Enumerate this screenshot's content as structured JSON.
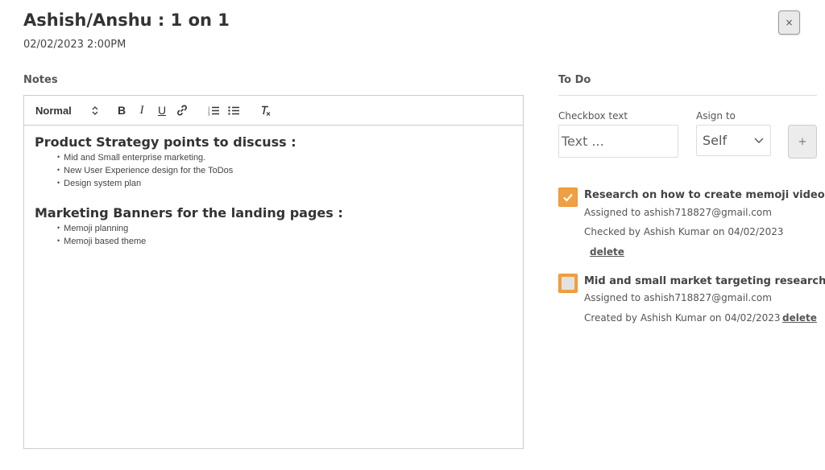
{
  "header": {
    "title": "Ashish/Anshu : 1 on 1",
    "datetime": "02/02/2023 2:00PM",
    "close_label": "×"
  },
  "notes": {
    "label": "Notes",
    "toolbar": {
      "format_select": "Normal",
      "bold": "B",
      "italic": "I",
      "underline": "U"
    },
    "sections": [
      {
        "heading": "Product Strategy points to discuss  :",
        "items": [
          "Mid and Small enterprise marketing.",
          "New User Experience design for the ToDos",
          "Design system plan"
        ]
      },
      {
        "heading": "Marketing Banners for the landing pages  :",
        "items": [
          "Memoji planning",
          "Memoji based theme"
        ]
      }
    ]
  },
  "todo": {
    "label": "To Do",
    "checkbox_text_label": "Checkbox text",
    "checkbox_text_placeholder": "Text ...",
    "assign_label": "Asign to",
    "assign_value": "Self",
    "add_label": "+",
    "accent_color": "#f0a040",
    "items": [
      {
        "title": "Research on how to create memoji videos",
        "assigned": "Assigned to ashish718827@gmail.com",
        "status": "Checked by Ashish Kumar on 04/02/2023",
        "delete_label": "delete",
        "checked": true
      },
      {
        "title": "Mid and small market targeting research",
        "assigned": "Assigned to ashish718827@gmail.com",
        "status": "Created by Ashish Kumar on 04/02/2023",
        "delete_label": "delete",
        "checked": false
      }
    ]
  }
}
